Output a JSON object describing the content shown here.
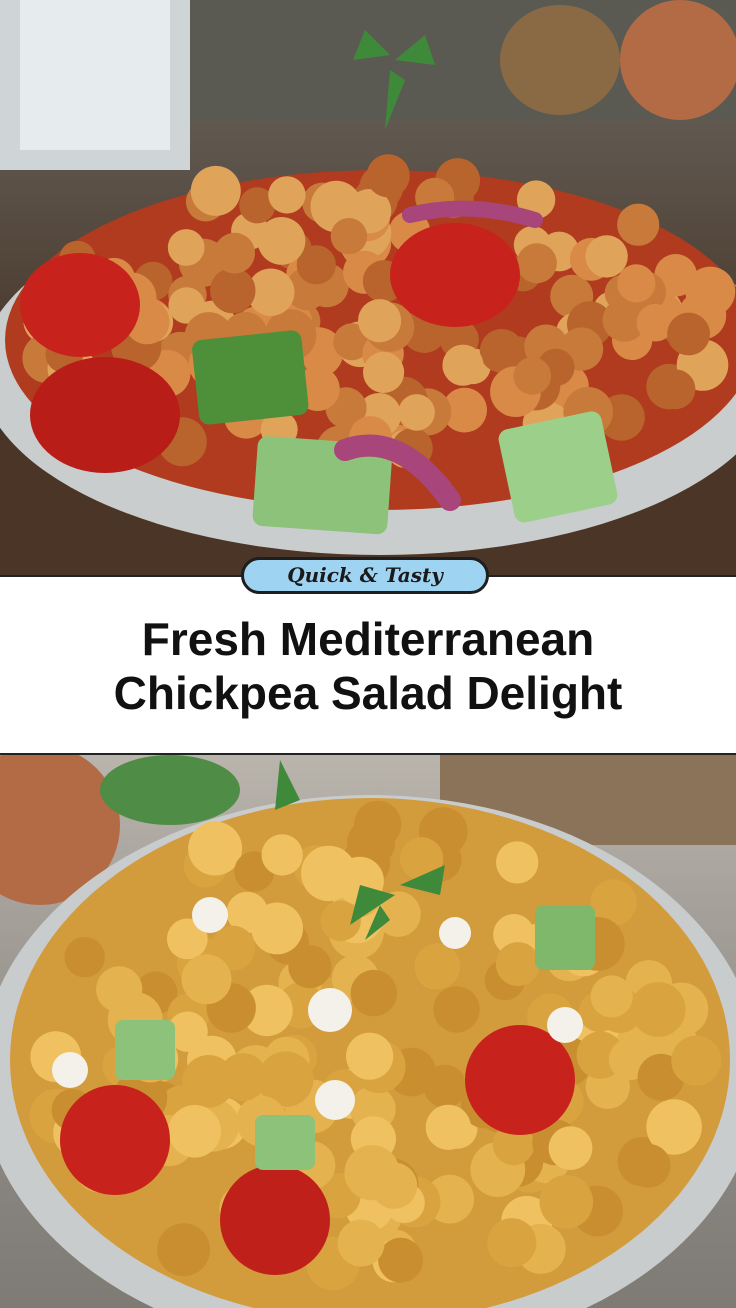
{
  "badge": {
    "label": "Quick & Tasty"
  },
  "headline": {
    "line1": "Fresh Mediterranean",
    "line2": "Chickpea Salad Delight"
  },
  "colors": {
    "badge_fill": "#9fd3f2",
    "chickpea_top": "#c87a3a",
    "chickpea_bottom": "#d9a440",
    "tomato": "#c8221c",
    "cucumber": "#7fb86a",
    "onion": "#a8457a",
    "feta": "#f4f1ea",
    "mint": "#3f8a3a",
    "plate": "#d9dcdd"
  },
  "images": [
    {
      "name": "top-salad-photo",
      "icon": "seasoned-chickpea-salad-plate"
    },
    {
      "name": "bottom-salad-photo",
      "icon": "chickpea-salad-bowl"
    }
  ]
}
